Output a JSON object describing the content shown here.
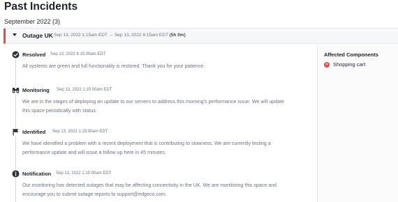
{
  "page": {
    "title": "Past Incidents",
    "month_label": "September 2022 (3)"
  },
  "incident": {
    "name": "Outage UK",
    "time_range": "Sep 13, 2022 1:15am EDT → Sep 13, 2022 6:15am EDT",
    "duration": "(5h 0m)",
    "status_color": "#e5484d",
    "updates": [
      {
        "status": "Resolved",
        "icon": "check-circle-icon",
        "time": "Sep 13, 2022 6:15:00am EDT",
        "message": "All systems are green and full functionality is restored. Thank you for your patience."
      },
      {
        "status": "Monitoring",
        "icon": "binoculars-icon",
        "time": "Sep 13, 2022 1:15:00am EDT",
        "message": "We are in the stages of deploying an update to our servers to address this morning's performance issue. We will update this space periodically with status."
      },
      {
        "status": "Identified",
        "icon": "flag-icon",
        "time": "Sep 13, 2022 1:15:00am EDT",
        "message": "We have identified a problem with a recent deployment that is contributing to slowness. We are currently testing a performance update and will issue a follow up here in 45 minutes."
      },
      {
        "status": "Notification",
        "icon": "info-circle-icon",
        "time": "Sep 13, 2022 1:15:00am EDT",
        "message": "Our monitoring has detected outages that may be affecting connectivity in the UK. We are monitoring this space and encourage you to submit outage reports to support@edgeco.com."
      }
    ]
  },
  "affected": {
    "title": "Affected Components",
    "components": [
      {
        "name": "Shopping cart",
        "icon": "x-circle-icon",
        "color": "#e5484d"
      }
    ]
  }
}
